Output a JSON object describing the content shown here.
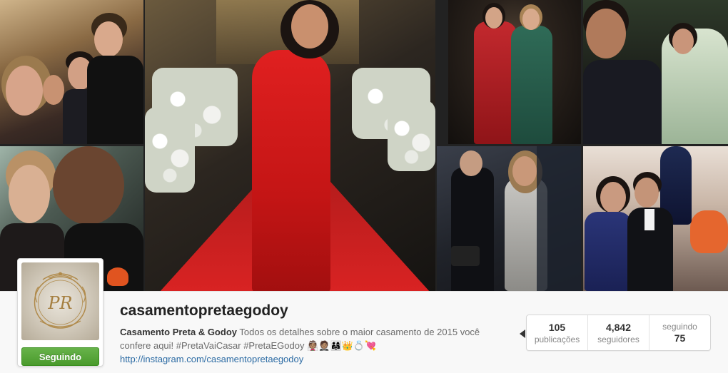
{
  "profile": {
    "username": "casamentopretaegodoy",
    "follow_button_label": "Seguindo",
    "display_name": "Casamento Preta & Godoy",
    "bio_text": "Todos os detalhes sobre o maior casamento de 2015 você confere aqui! #PretaVaiCasar #PretaEGodoy 👰🏽🤵🏽👨‍👩‍👧👑💍💘",
    "website": "http://instagram.com/casamentopretaegodoy",
    "avatar_monogram": "PR"
  },
  "stats": {
    "posts_count": "105",
    "posts_label": "publicações",
    "followers_count": "4,842",
    "followers_label": "seguidores",
    "following_label": "seguindo",
    "following_count": "75"
  },
  "mosaic": {
    "tiles": [
      {
        "name": "photo-tile-1",
        "subject": "group-selfie-church"
      },
      {
        "name": "photo-tile-2",
        "subject": "woman-red-dress-aisle"
      },
      {
        "name": "photo-tile-3",
        "subject": "two-women-gowns"
      },
      {
        "name": "photo-tile-4",
        "subject": "car-selfie"
      },
      {
        "name": "photo-tile-5",
        "subject": "couple-selfie"
      },
      {
        "name": "photo-tile-6",
        "subject": "woman-silver-dress-photographers"
      },
      {
        "name": "photo-tile-7",
        "subject": "couple-with-statue"
      }
    ]
  },
  "colors": {
    "follow_button": "#4a9a2c",
    "link": "#2a6aa3",
    "username": "#222222"
  }
}
